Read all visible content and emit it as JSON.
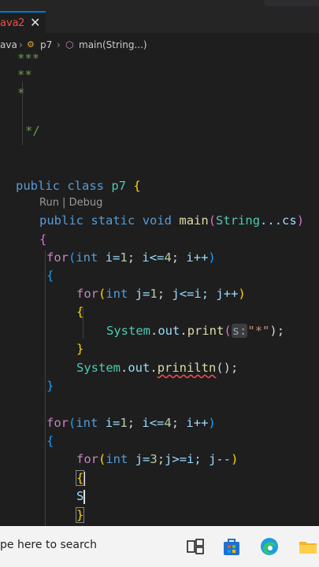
{
  "tab": {
    "name": "ava",
    "problem_count": "2",
    "close_glyph": "✕"
  },
  "breadcrumbs": {
    "file": "ava",
    "sep1": "›",
    "class_name": "p7",
    "sep2": "›",
    "method": "main(String...)"
  },
  "codelens": "Run | Debug",
  "code": {
    "c1": "***",
    "c2": "**",
    "c3": "*",
    "c4": "*/",
    "public": "public",
    "class": "class",
    "class_name": "p7",
    "brace_open": "{",
    "static": "static",
    "void": "void",
    "main": "main",
    "string_type": "String",
    "varargs": "...cs",
    "lparen": "(",
    "rparen": ")",
    "for": "for",
    "int": "int",
    "i_init": "i=",
    "one": "1",
    "semi": ";",
    "i_cond": "i<=",
    "four": "4",
    "i_inc": "i++",
    "j_init": "j=",
    "j_cond": "j<=i;",
    "j_inc": "j++",
    "system": "System",
    "dot": ".",
    "out": "out",
    "print": "print",
    "param_hint": "s:",
    "star_string": "\"*\"",
    "stmt_end": ");",
    "println": "priniltn",
    "println_call": "();",
    "brace_close": "}",
    "j_init2": "j=",
    "three": "3",
    "j_cond2": "j>=i;",
    "j_dec": "j--",
    "partial_s": "S"
  },
  "taskbar": {
    "search_placeholder": "pe here to search"
  },
  "icons": [
    "java-file-icon",
    "class-icon",
    "method-icon",
    "task-view-icon",
    "store-icon",
    "edge-icon",
    "folder-icon"
  ],
  "colors": {
    "keyword": "#569cd6",
    "control": "#c586c0",
    "type": "#4ec9b0",
    "function": "#dcdcaa",
    "comment": "#6a9955",
    "error": "#f14c4c"
  }
}
